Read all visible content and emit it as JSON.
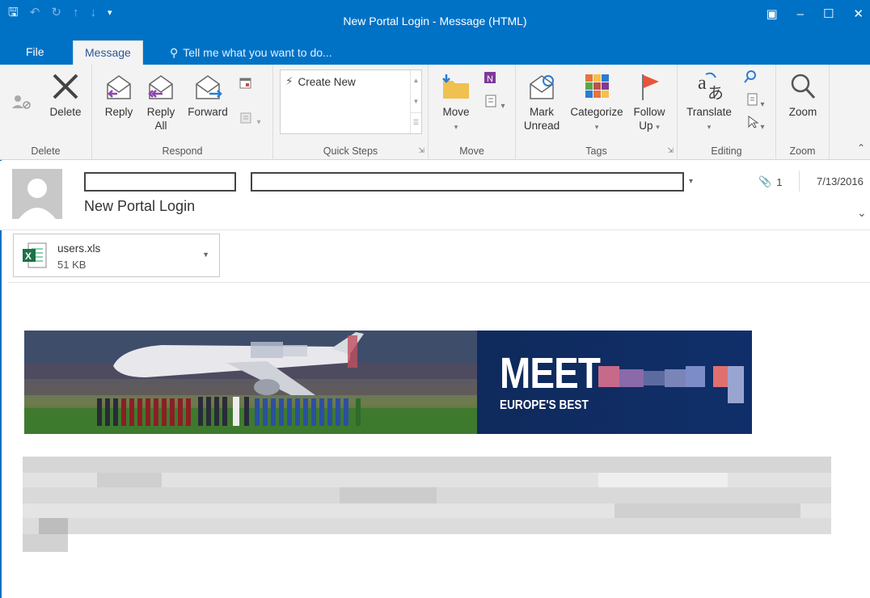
{
  "window": {
    "title": "New Portal Login - Message (HTML)"
  },
  "tabs": {
    "file": "File",
    "message": "Message",
    "tell_me": "Tell me what you want to do..."
  },
  "ribbon": {
    "delete_group": {
      "delete": "Delete",
      "label": "Delete"
    },
    "respond_group": {
      "reply": "Reply",
      "reply_all_1": "Reply",
      "reply_all_2": "All",
      "forward": "Forward",
      "label": "Respond"
    },
    "quick_steps": {
      "create_new": "Create New",
      "label": "Quick Steps"
    },
    "move_group": {
      "move": "Move",
      "label": "Move"
    },
    "tags_group": {
      "mark_unread_1": "Mark",
      "mark_unread_2": "Unread",
      "categorize": "Categorize",
      "follow_up_1": "Follow",
      "follow_up_2": "Up",
      "label": "Tags"
    },
    "editing_group": {
      "translate": "Translate",
      "label": "Editing"
    },
    "zoom_group": {
      "zoom": "Zoom",
      "label": "Zoom"
    }
  },
  "message": {
    "subject": "New Portal Login",
    "attachment_count": "1",
    "date": "7/13/2016"
  },
  "attachment": {
    "name": "users.xls",
    "size": "51 KB"
  },
  "banner": {
    "headline": "MEET",
    "subline": "EUROPE'S BEST"
  },
  "colors": {
    "accent": "#0072c6",
    "ribbon": "#f3f3f3"
  }
}
